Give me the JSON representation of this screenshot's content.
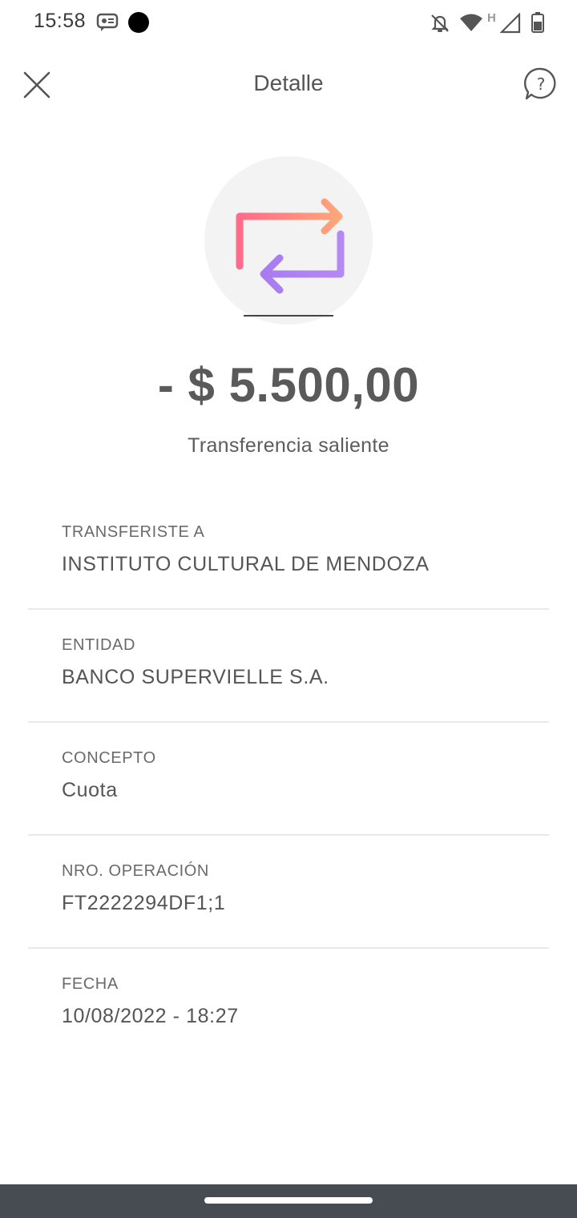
{
  "status_bar": {
    "time": "15:58",
    "icons": [
      "message-icon",
      "notification-dot-icon",
      "bell-off-icon",
      "wifi-icon",
      "signal-h-icon",
      "battery-icon"
    ],
    "network_label": "H"
  },
  "header": {
    "title": "Detalle",
    "close_icon": "close-icon",
    "help_icon": "help-icon"
  },
  "transaction": {
    "icon": "transfer-icon",
    "amount": "- $ 5.500,00",
    "type": "Transferencia saliente"
  },
  "details": [
    {
      "label": "TRANSFERISTE A",
      "value": "INSTITUTO CULTURAL DE MENDOZA"
    },
    {
      "label": "ENTIDAD",
      "value": "BANCO SUPERVIELLE S.A."
    },
    {
      "label": "CONCEPTO",
      "value": "Cuota"
    },
    {
      "label": "NRO. OPERACIÓN",
      "value": "FT2222294DF1;1"
    },
    {
      "label": "FECHA",
      "value": "10/08/2022 - 18:27"
    }
  ],
  "colors": {
    "icon_gradient_start": "#ff6b8a",
    "icon_gradient_mid": "#ffa77a",
    "icon_gradient_purple": "#a87cf0",
    "nav_bar": "#474b52"
  }
}
